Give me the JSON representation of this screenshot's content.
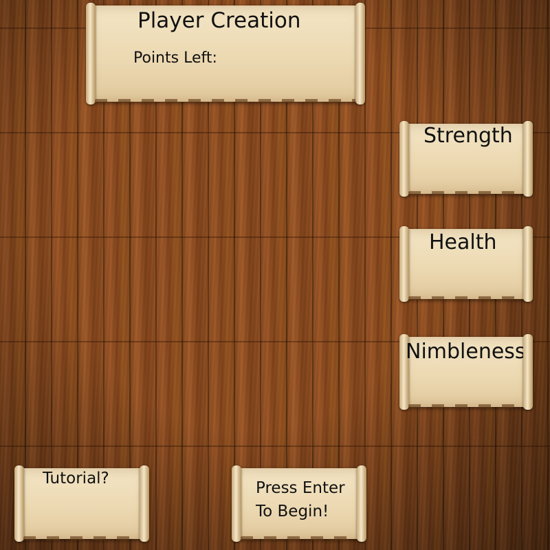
{
  "header": {
    "title": "Player Creation",
    "points_label": "Points Left:"
  },
  "stats": {
    "strength_label": "Strength",
    "health_label": "Health",
    "nimbleness_label": "Nimbleness"
  },
  "footer": {
    "tutorial_label": "Tutorial?",
    "begin_line1": "Press Enter",
    "begin_line2": "To Begin!"
  },
  "colors": {
    "parchment": "#ecd9b2",
    "wood": "#8a4a1f",
    "text": "#111111"
  }
}
